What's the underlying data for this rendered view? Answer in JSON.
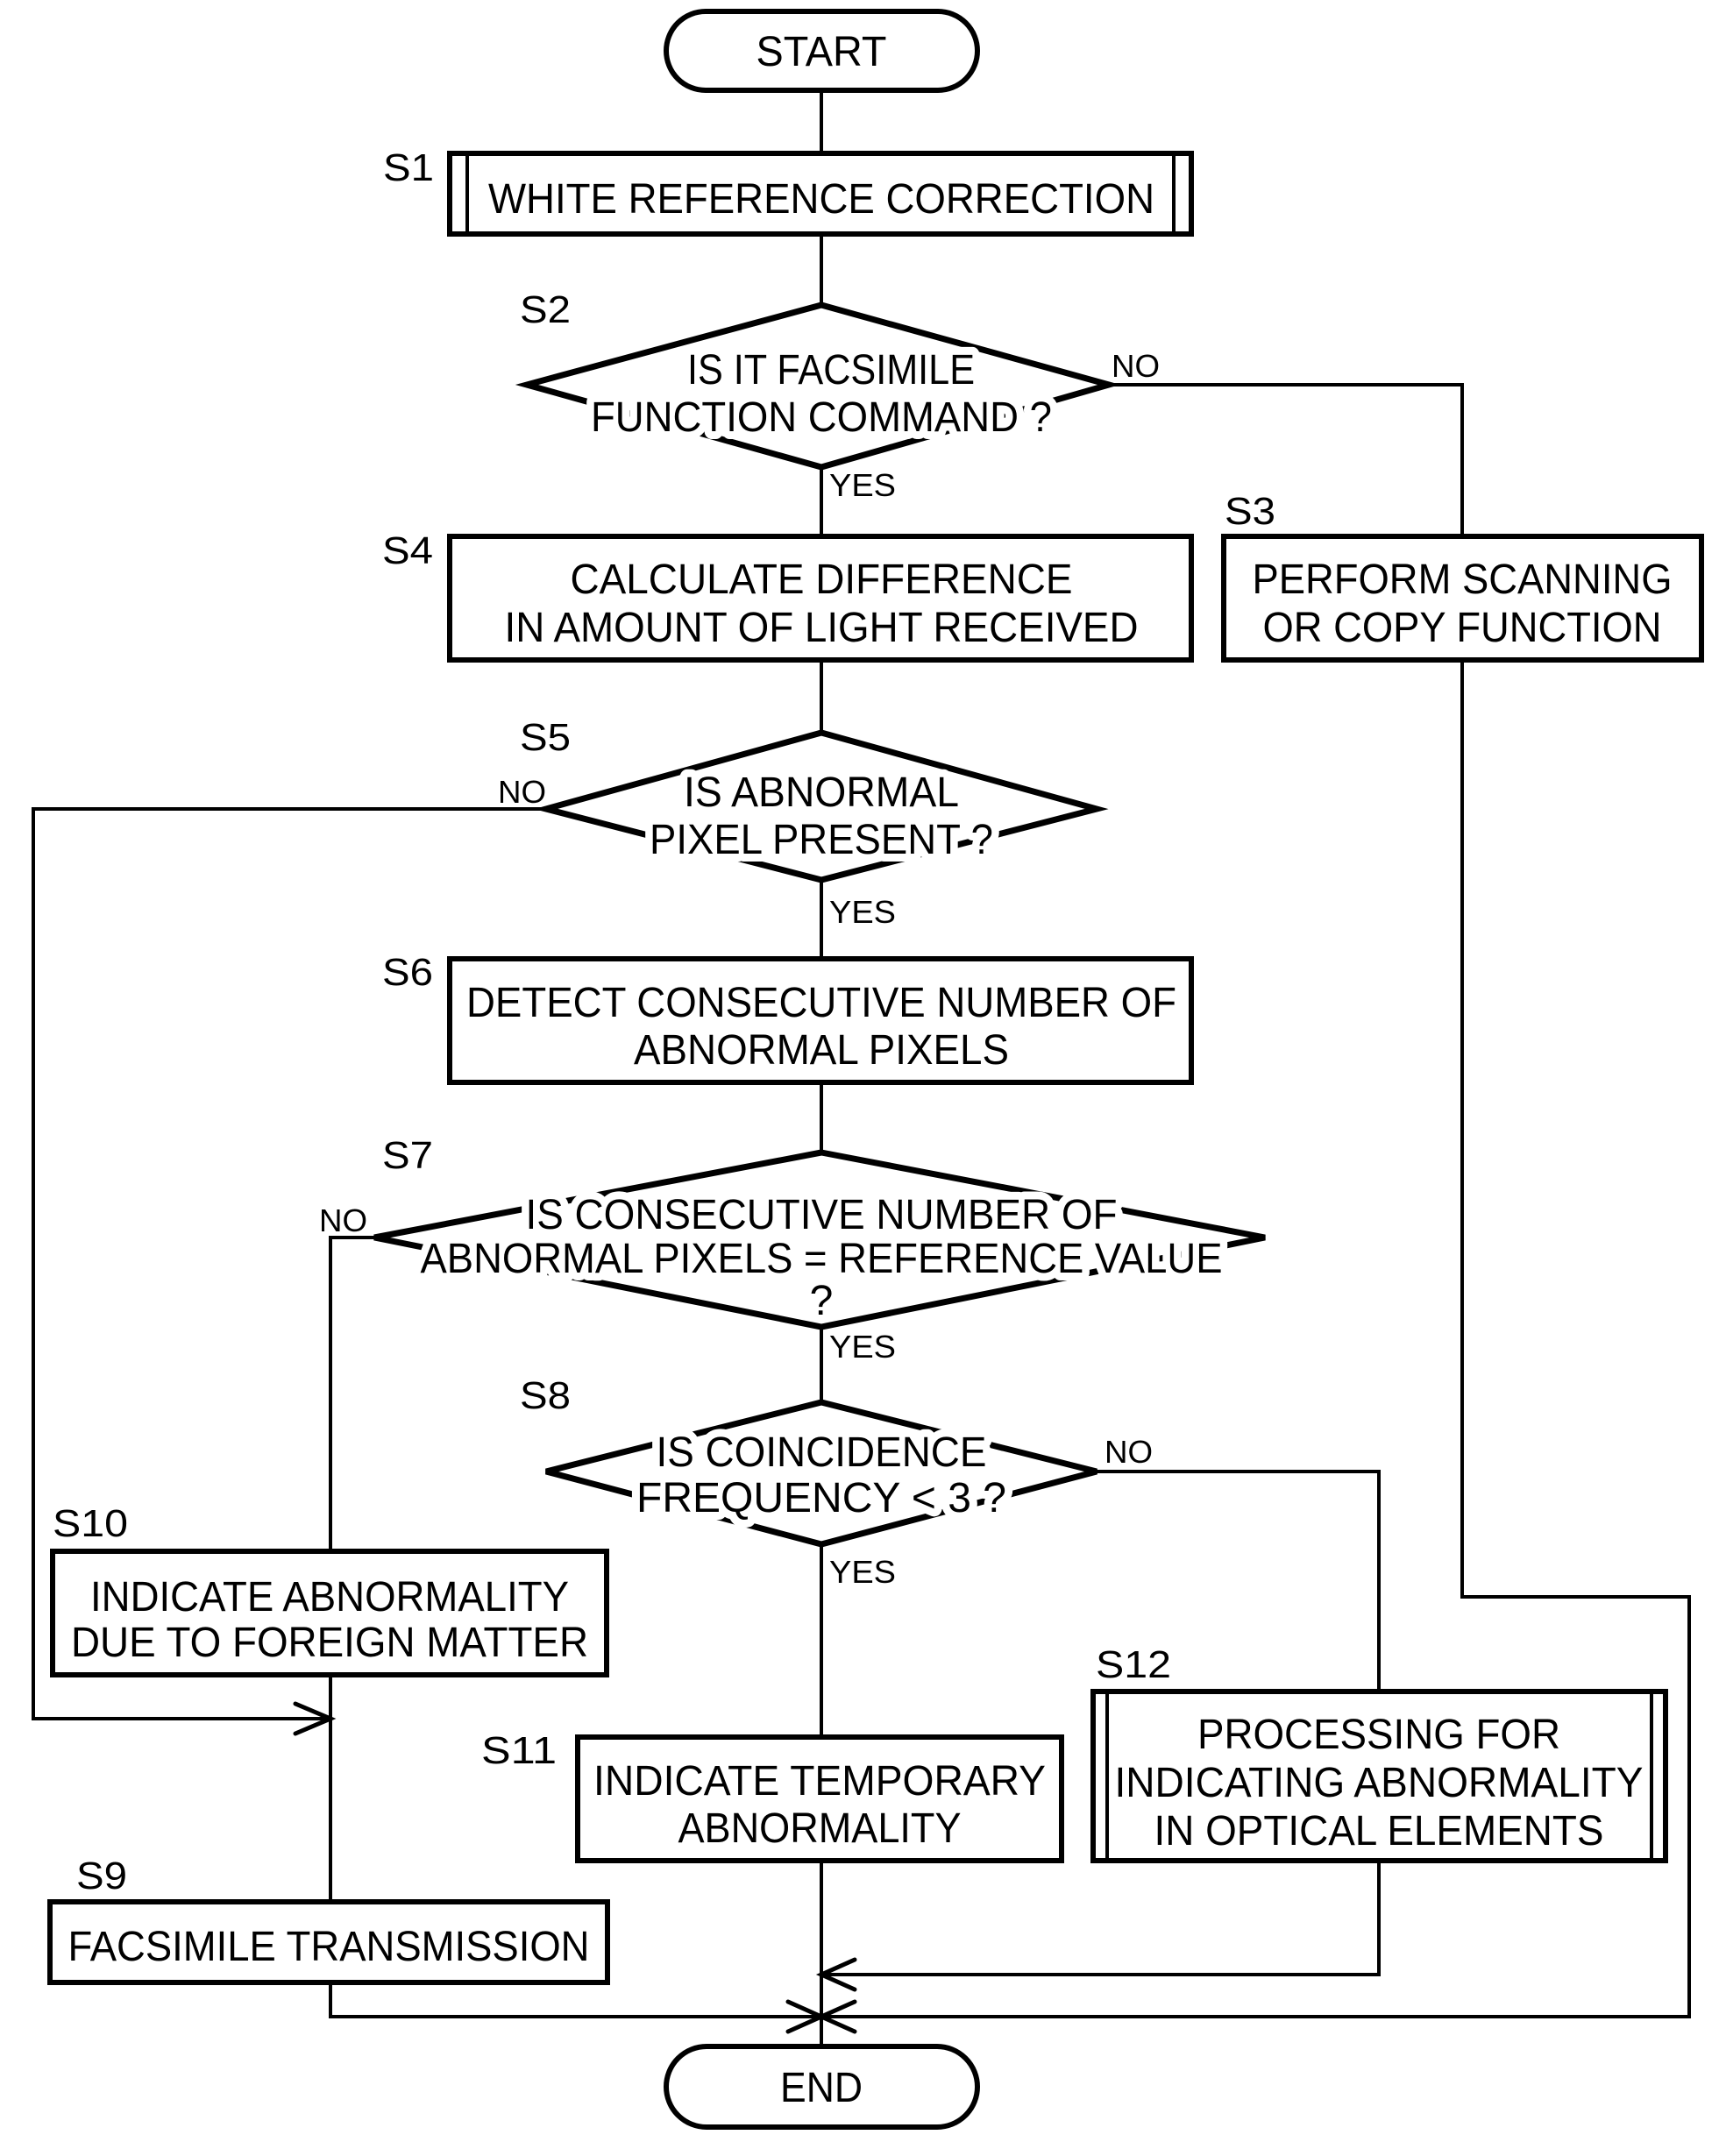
{
  "figure": {
    "type": "flowchart",
    "start": "START",
    "end": "END",
    "steps": {
      "s1": {
        "id": "S1",
        "kind": "predefined-process",
        "lines": [
          "WHITE REFERENCE CORRECTION"
        ]
      },
      "s2": {
        "id": "S2",
        "kind": "decision",
        "lines": [
          "IS IT FACSIMILE",
          "FUNCTION COMMAND ?"
        ],
        "yes": "YES",
        "no": "NO"
      },
      "s3": {
        "id": "S3",
        "kind": "process",
        "lines": [
          "PERFORM SCANNING",
          "OR COPY FUNCTION"
        ]
      },
      "s4": {
        "id": "S4",
        "kind": "process",
        "lines": [
          "CALCULATE DIFFERENCE",
          "IN AMOUNT OF LIGHT RECEIVED"
        ]
      },
      "s5": {
        "id": "S5",
        "kind": "decision",
        "lines": [
          "IS ABNORMAL",
          "PIXEL PRESENT ?"
        ],
        "yes": "YES",
        "no": "NO"
      },
      "s6": {
        "id": "S6",
        "kind": "process",
        "lines": [
          "DETECT CONSECUTIVE NUMBER OF",
          "ABNORMAL PIXELS"
        ]
      },
      "s7": {
        "id": "S7",
        "kind": "decision",
        "lines": [
          "IS CONSECUTIVE NUMBER OF",
          "ABNORMAL PIXELS = REFERENCE VALUE",
          "?"
        ],
        "yes": "YES",
        "no": "NO"
      },
      "s8": {
        "id": "S8",
        "kind": "decision",
        "lines": [
          "IS COINCIDENCE",
          "FREQUENCY < 3 ?"
        ],
        "yes": "YES",
        "no": "NO"
      },
      "s9": {
        "id": "S9",
        "kind": "process",
        "lines": [
          "FACSIMILE TRANSMISSION"
        ]
      },
      "s10": {
        "id": "S10",
        "kind": "process",
        "lines": [
          "INDICATE ABNORMALITY",
          "DUE TO FOREIGN MATTER"
        ]
      },
      "s11": {
        "id": "S11",
        "kind": "process",
        "lines": [
          "INDICATE TEMPORARY",
          "ABNORMALITY"
        ]
      },
      "s12": {
        "id": "S12",
        "kind": "predefined-process",
        "lines": [
          "PROCESSING FOR",
          "INDICATING ABNORMALITY",
          "IN OPTICAL ELEMENTS"
        ]
      }
    },
    "edges": [
      {
        "from": "START",
        "to": "S1"
      },
      {
        "from": "S1",
        "to": "S2"
      },
      {
        "from": "S2",
        "to": "S4",
        "label": "YES"
      },
      {
        "from": "S2",
        "to": "S3",
        "label": "NO"
      },
      {
        "from": "S4",
        "to": "S5"
      },
      {
        "from": "S5",
        "to": "S6",
        "label": "YES"
      },
      {
        "from": "S5",
        "to": "S9",
        "label": "NO"
      },
      {
        "from": "S6",
        "to": "S7"
      },
      {
        "from": "S7",
        "to": "S8",
        "label": "YES"
      },
      {
        "from": "S7",
        "to": "S10",
        "label": "NO"
      },
      {
        "from": "S8",
        "to": "S11",
        "label": "YES"
      },
      {
        "from": "S8",
        "to": "S12",
        "label": "NO"
      },
      {
        "from": "S10",
        "to": "S9"
      },
      {
        "from": "S9",
        "to": "END"
      },
      {
        "from": "S11",
        "to": "END"
      },
      {
        "from": "S12",
        "to": "END"
      },
      {
        "from": "S3",
        "to": "END"
      }
    ]
  }
}
